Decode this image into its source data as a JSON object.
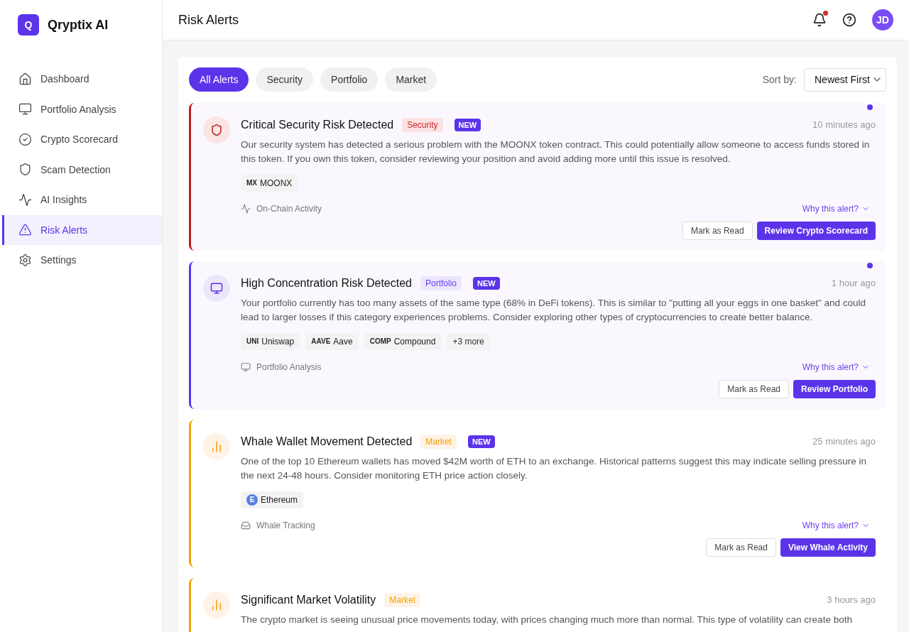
{
  "brand": {
    "logo": "Q",
    "name": "Qryptix AI"
  },
  "sidebar": {
    "items": [
      {
        "label": "Dashboard",
        "selected": false
      },
      {
        "label": "Portfolio Analysis",
        "selected": false
      },
      {
        "label": "Crypto Scorecard",
        "selected": false
      },
      {
        "label": "Scam Detection",
        "selected": false
      },
      {
        "label": "AI Insights",
        "selected": false
      },
      {
        "label": "Risk Alerts",
        "selected": true
      },
      {
        "label": "Settings",
        "selected": false
      }
    ]
  },
  "header": {
    "title": "Risk Alerts",
    "notifications_unread": true,
    "avatar": "JD"
  },
  "filters": [
    {
      "label": "All Alerts",
      "selected": true
    },
    {
      "label": "Security",
      "selected": false
    },
    {
      "label": "Portfolio",
      "selected": false
    },
    {
      "label": "Market",
      "selected": false
    }
  ],
  "sort": {
    "label": "Sort by:",
    "value": "Newest First"
  },
  "alerts": [
    {
      "kind": "security",
      "title": "Critical Security Risk Detected",
      "category": "Security",
      "badge": "NEW",
      "unread": true,
      "time": "10 minutes ago",
      "description": "Our security system has detected a serious problem with the MOONX token contract. This could potentially allow someone to access funds stored in this token. If you own this token, consider reviewing your position and avoid adding more until this issue is resolved.",
      "tokens": [
        {
          "kind": "ticker",
          "symbol": "MX",
          "name": "MOONX"
        }
      ],
      "source": "On-Chain Activity",
      "why": "Why this alert?",
      "secondary": "Mark as Read",
      "primary": "Review Crypto Scorecard"
    },
    {
      "kind": "portfolio",
      "title": "High Concentration Risk Detected",
      "category": "Portfolio",
      "badge": "NEW",
      "unread": true,
      "time": "1 hour ago",
      "description": "Your portfolio currently has too many assets of the same type (68% in DeFi tokens). This is similar to \"putting all your eggs in one basket\" and could lead to larger losses if this category experiences problems. Consider exploring other types of cryptocurrencies to create better balance.",
      "tokens": [
        {
          "kind": "ticker",
          "symbol": "UNI",
          "name": "Uniswap"
        },
        {
          "kind": "ticker",
          "symbol": "AAVE",
          "name": "Aave"
        },
        {
          "kind": "ticker",
          "symbol": "COMP",
          "name": "Compound"
        },
        {
          "kind": "more",
          "name": "+3 more"
        }
      ],
      "source": "Portfolio Analysis",
      "why": "Why this alert?",
      "secondary": "Mark as Read",
      "primary": "Review Portfolio"
    },
    {
      "kind": "market",
      "title": "Whale Wallet Movement Detected",
      "category": "Market",
      "badge": "NEW",
      "unread": false,
      "time": "25 minutes ago",
      "description": "One of the top 10 Ethereum wallets has moved $42M worth of ETH to an exchange. Historical patterns suggest this may indicate selling pressure in the next 24-48 hours. Consider monitoring ETH price action closely.",
      "tokens": [
        {
          "kind": "coin",
          "symbol": "E",
          "name": "Ethereum"
        }
      ],
      "source": "Whale Tracking",
      "why": "Why this alert?",
      "secondary": "Mark as Read",
      "primary": "View Whale Activity"
    },
    {
      "kind": "market",
      "title": "Significant Market Volatility",
      "category": "Market",
      "unread": false,
      "time": "3 hours ago",
      "description": "The crypto market is seeing unusual price movements today, with prices changing much more than normal. This type of volatility can create both"
    }
  ]
}
